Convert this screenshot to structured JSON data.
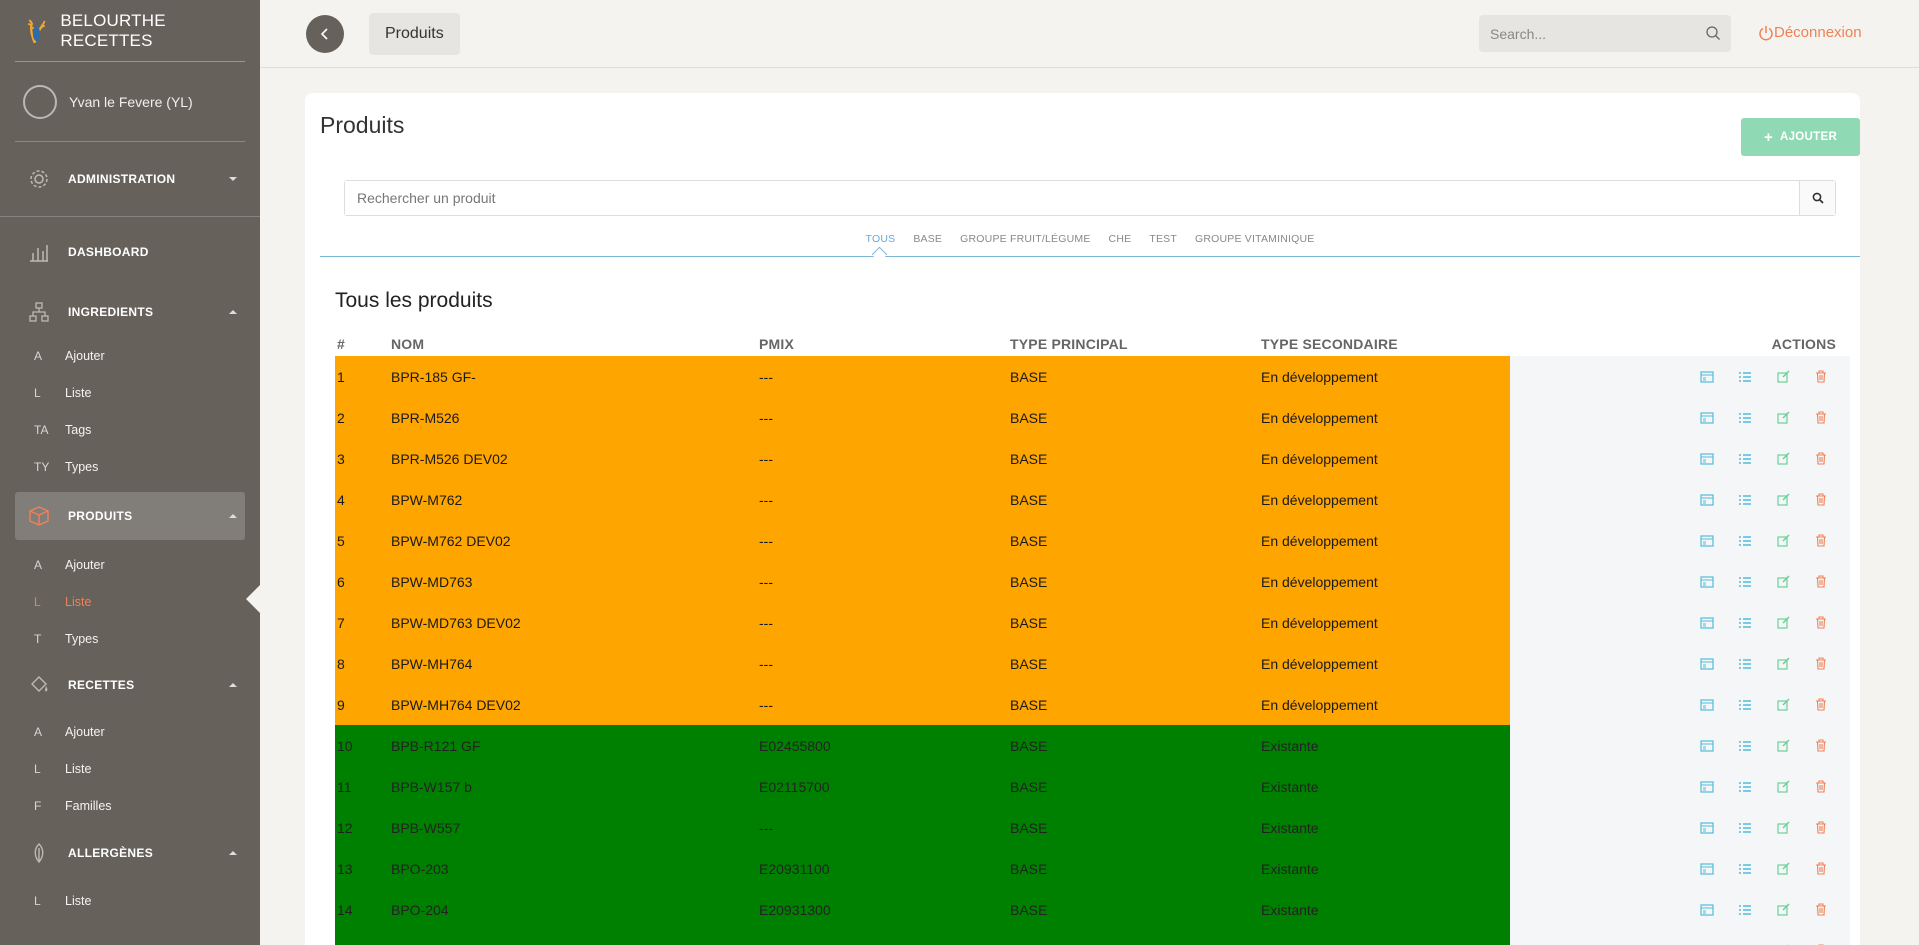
{
  "app": {
    "brand": "BELOURTHE RECETTES",
    "user": "Yvan le Fevere (YL)"
  },
  "sidebar": {
    "admin": "ADMINISTRATION",
    "dashboard": "DASHBOARD",
    "ingredients": {
      "label": "INGREDIENTS",
      "items": [
        {
          "abbr": "A",
          "label": "Ajouter"
        },
        {
          "abbr": "L",
          "label": "Liste"
        },
        {
          "abbr": "TA",
          "label": "Tags"
        },
        {
          "abbr": "TY",
          "label": "Types"
        }
      ]
    },
    "produits": {
      "label": "PRODUITS",
      "items": [
        {
          "abbr": "A",
          "label": "Ajouter"
        },
        {
          "abbr": "L",
          "label": "Liste"
        },
        {
          "abbr": "T",
          "label": "Types"
        }
      ]
    },
    "recettes": {
      "label": "RECETTES",
      "items": [
        {
          "abbr": "A",
          "label": "Ajouter"
        },
        {
          "abbr": "L",
          "label": "Liste"
        },
        {
          "abbr": "F",
          "label": "Familles"
        }
      ]
    },
    "allergenes": {
      "label": "ALLERGÈNES",
      "items": [
        {
          "abbr": "L",
          "label": "Liste"
        }
      ]
    }
  },
  "topbar": {
    "breadcrumb": "Produits",
    "search_placeholder": "Search...",
    "logout": "Déconnexion"
  },
  "main": {
    "title": "Produits",
    "add_button": "AJOUTER",
    "search_placeholder": "Rechercher un produit",
    "tabs": [
      "TOUS",
      "BASE",
      "GROUPE FRUIT/LÉGUME",
      "CHE",
      "TEST",
      "GROUPE VITAMINIQUE"
    ],
    "active_tab": "TOUS",
    "section_title": "Tous les produits"
  },
  "table": {
    "headers": {
      "idx": "#",
      "nom": "NOM",
      "pmix": "PMIX",
      "type": "TYPE PRINCIPAL",
      "sec": "TYPE SECONDAIRE",
      "actions": "ACTIONS"
    },
    "rows": [
      {
        "idx": "1",
        "nom": "BPR-185 GF-",
        "pmix": "---",
        "type": "BASE",
        "sec": "En développement",
        "status": "dev"
      },
      {
        "idx": "2",
        "nom": "BPR-M526",
        "pmix": "---",
        "type": "BASE",
        "sec": "En développement",
        "status": "dev"
      },
      {
        "idx": "3",
        "nom": "BPR-M526 DEV02",
        "pmix": "---",
        "type": "BASE",
        "sec": "En développement",
        "status": "dev"
      },
      {
        "idx": "4",
        "nom": "BPW-M762",
        "pmix": "---",
        "type": "BASE",
        "sec": "En développement",
        "status": "dev"
      },
      {
        "idx": "5",
        "nom": "BPW-M762 DEV02",
        "pmix": "---",
        "type": "BASE",
        "sec": "En développement",
        "status": "dev"
      },
      {
        "idx": "6",
        "nom": "BPW-MD763",
        "pmix": "---",
        "type": "BASE",
        "sec": "En développement",
        "status": "dev"
      },
      {
        "idx": "7",
        "nom": "BPW-MD763 DEV02",
        "pmix": "---",
        "type": "BASE",
        "sec": "En développement",
        "status": "dev"
      },
      {
        "idx": "8",
        "nom": "BPW-MH764",
        "pmix": "---",
        "type": "BASE",
        "sec": "En développement",
        "status": "dev"
      },
      {
        "idx": "9",
        "nom": "BPW-MH764 DEV02",
        "pmix": "---",
        "type": "BASE",
        "sec": "En développement",
        "status": "dev"
      },
      {
        "idx": "10",
        "nom": "BPB-R121 GF",
        "pmix": "E02455800",
        "type": "BASE",
        "sec": "Existante",
        "status": "existing"
      },
      {
        "idx": "11",
        "nom": "BPB-W157 b",
        "pmix": "E02115700",
        "type": "BASE",
        "sec": "Existante",
        "status": "existing"
      },
      {
        "idx": "12",
        "nom": "BPB-W557",
        "pmix": "---",
        "type": "BASE",
        "sec": "Existante",
        "status": "existing"
      },
      {
        "idx": "13",
        "nom": "BPO-203",
        "pmix": "E20931100",
        "type": "BASE",
        "sec": "Existante",
        "status": "existing"
      },
      {
        "idx": "14",
        "nom": "BPO-204",
        "pmix": "E20931300",
        "type": "BASE",
        "sec": "Existante",
        "status": "existing"
      },
      {
        "idx": "",
        "nom": "",
        "pmix": "",
        "type": "",
        "sec": "",
        "status": "existing"
      }
    ]
  },
  "colors": {
    "sidebar_bg": "#66615b",
    "accent": "#ef8157",
    "dev_row": "#ffa500",
    "existing_row": "#008000",
    "action_info": "#51bcda",
    "action_success": "#6bd098",
    "action_danger": "#ef8157",
    "add_button": "#8fd9b4"
  },
  "icons": [
    "back-arrow-icon",
    "search-icon",
    "power-icon",
    "plus-icon",
    "gear-icon",
    "bar-chart-icon",
    "sitemap-icon",
    "box-icon",
    "paint-bucket-icon",
    "leaf-icon",
    "card-view-icon",
    "list-view-icon",
    "edit-icon",
    "trash-icon"
  ]
}
